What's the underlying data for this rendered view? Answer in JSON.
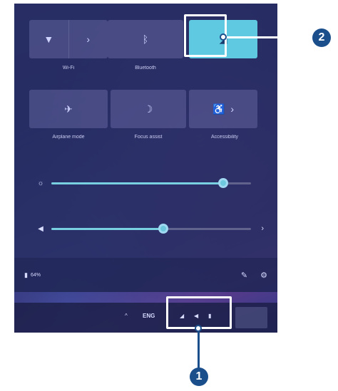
{
  "quick_settings": {
    "tiles_row1": [
      {
        "label": "Wi-Fi",
        "icon": "wifi-icon",
        "glyph": "▼",
        "glyph2": "›",
        "state": "off"
      },
      {
        "label": "Bluetooth",
        "icon": "bluetooth-icon",
        "glyph": "ᛒ",
        "state": "off"
      },
      {
        "label": "",
        "icon": "cellular-icon",
        "glyph": "◢",
        "state": "on"
      }
    ],
    "tiles_row2": [
      {
        "label": "Airplane mode",
        "icon": "airplane-icon",
        "glyph": "✈",
        "state": "off"
      },
      {
        "label": "Focus assist",
        "icon": "moon-icon",
        "glyph": "☽",
        "state": "off"
      },
      {
        "label": "Accessibility",
        "icon": "accessibility-icon",
        "glyph": "♿",
        "glyph2": "›",
        "state": "off"
      }
    ],
    "brightness": {
      "icon": "brightness-icon",
      "glyph": "☼",
      "level_percent": 86
    },
    "volume": {
      "icon": "speaker-icon",
      "glyph": "◀",
      "level_percent": 56,
      "chevron": "›"
    },
    "battery_text": "64%",
    "battery_glyph": "▮",
    "edit_glyph": "✎",
    "settings_glyph": "⚙"
  },
  "taskbar": {
    "chevron_glyph": "^",
    "language": "ENG",
    "tray_glyphs": {
      "network": "◢",
      "volume": "◀",
      "battery": "▮"
    }
  },
  "callouts": {
    "one": "1",
    "two": "2"
  },
  "colors": {
    "accent": "#5ec9e0",
    "callout": "#1b4f8c"
  }
}
